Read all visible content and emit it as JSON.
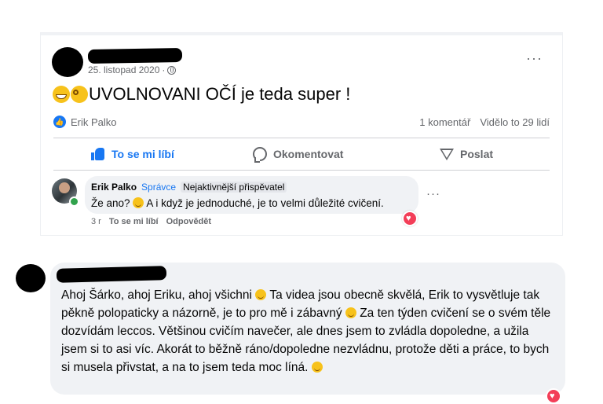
{
  "post": {
    "date": "25. listopad 2020",
    "separator": "·",
    "text": "UVOLNOVANI OČÍ je teda super !",
    "more": "···",
    "reactor": "Erik Palko",
    "comments_count": "1 komentář",
    "views": "Vidělo to 29 lidí",
    "actions": {
      "like": "To se mi líbí",
      "comment": "Okomentovat",
      "share": "Poslat"
    }
  },
  "comment": {
    "name": "Erik Palko",
    "role": "Správce",
    "badge": "Nejaktivnější přispěvatel",
    "text_a": "Že ano?",
    "text_b": "A i když je jednoduché, je to velmi důležité cvičení.",
    "time": "3 r",
    "like": "To se mi líbí",
    "reply": "Odpovědět",
    "more": "···"
  },
  "reply": {
    "part1": "Ahoj Šárko, ahoj Eriku, ahoj všichni",
    "part2": "Ta videa jsou obecně skvělá, Erik to vysvětluje tak pěkně polopaticky a názorně, je to pro mě i zábavný",
    "part3": "Za ten týden cvičení se o svém těle dozvídám leccos. Většinou cvičím navečer, ale dnes jsem to zvládla dopoledne, a užila jsem si to asi víc. Akorát to běžně ráno/dopoledne nezvládnu, protože děti a práce, to bych si musela přivstat, a na to jsem teda moc líná."
  },
  "colors": {
    "accent": "#1877f2",
    "bubble": "#f0f2f5",
    "love": "#f33e58"
  }
}
